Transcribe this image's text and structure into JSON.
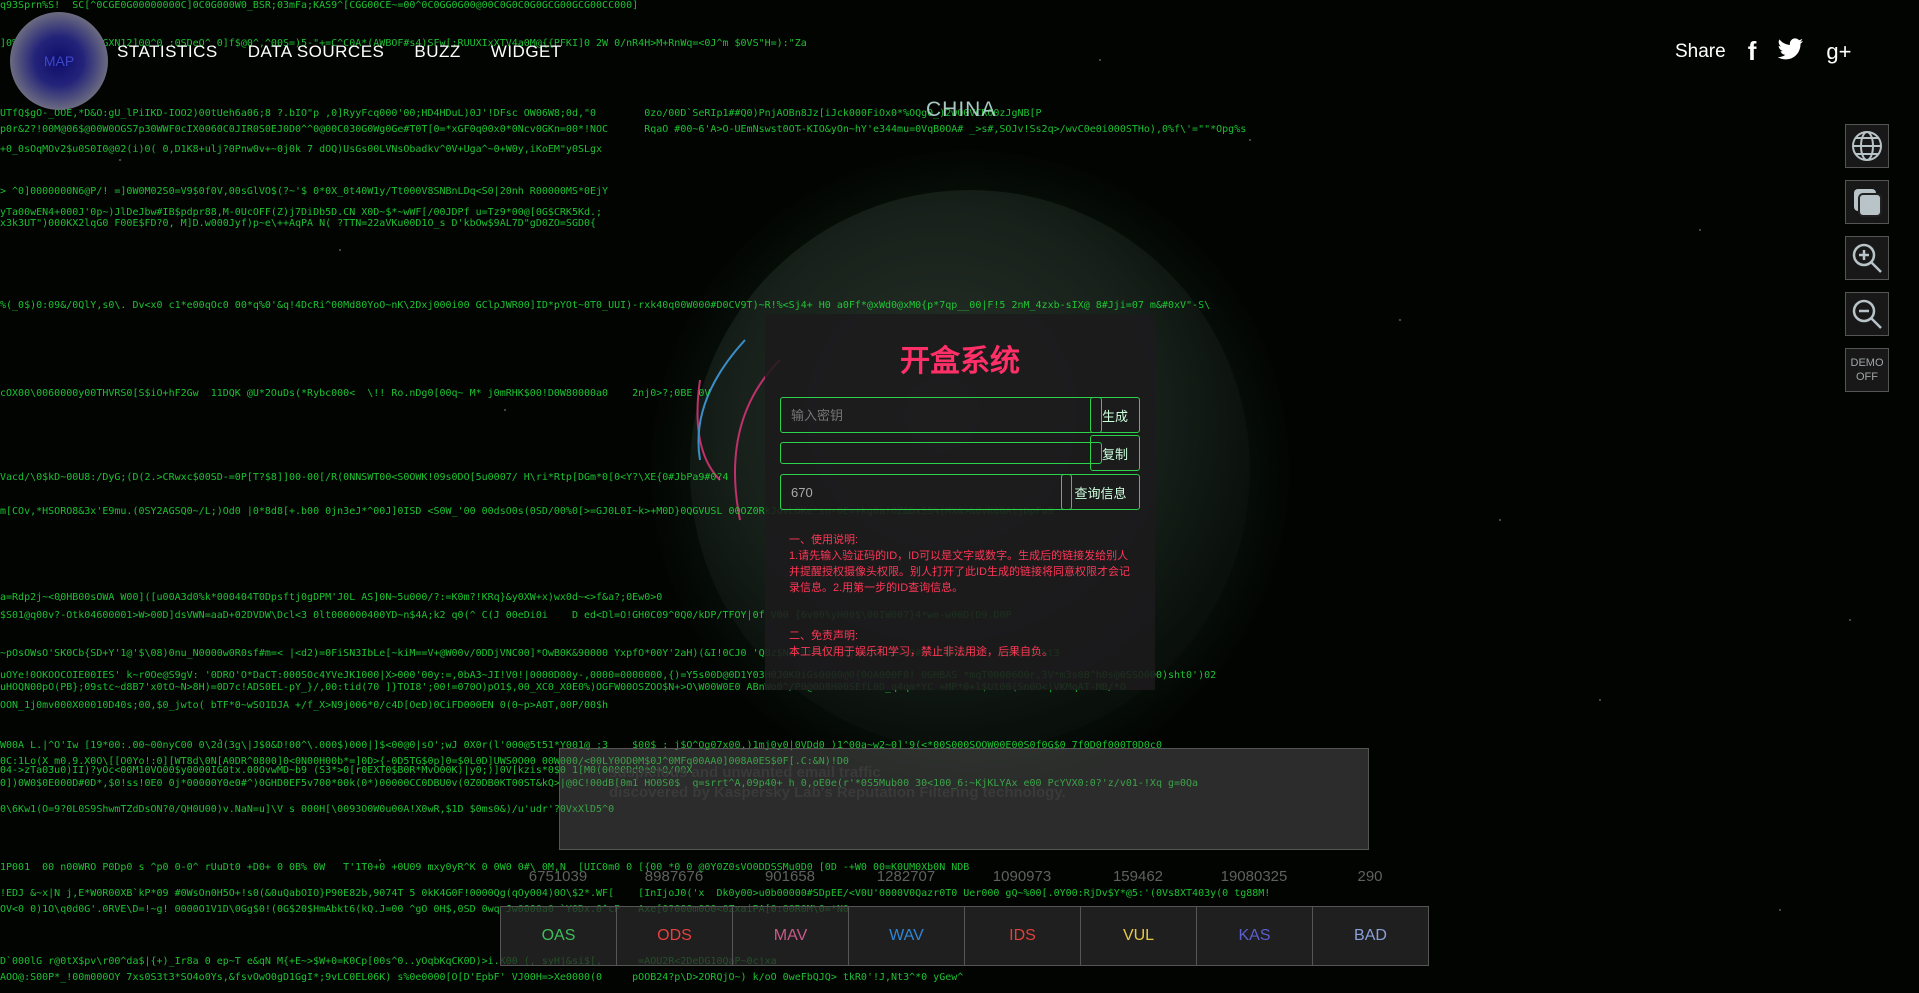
{
  "header": {
    "logo_text": "MAP",
    "nav": [
      "STATISTICS",
      "DATA SOURCES",
      "BUZZ",
      "WIDGET"
    ],
    "share_label": "Share",
    "social": [
      {
        "name": "facebook",
        "glyph": "f"
      },
      {
        "name": "twitter",
        "glyph": "t"
      },
      {
        "name": "google-plus",
        "glyph": "g+"
      }
    ]
  },
  "country": "CHINA",
  "tools": {
    "demo_line1": "DEMO",
    "demo_line2": "OFF"
  },
  "modal": {
    "title": "开盒系统",
    "key_placeholder": "输入密钥",
    "generate_label": "生成",
    "link_value": "",
    "copy_label": "复制",
    "id_value": "670",
    "query_label": "查询信息",
    "usage_heading": "一、使用说明:",
    "usage_text": "1.请先输入验证码的ID，ID可以是文字或数字。生成后的链接发给别人并提醒授权摄像头权限。别人打开了此ID生成的链接将同意权限才会记录信息。2.用第一步的ID查询信息。",
    "disclaimer_heading": "二、免责声明:",
    "disclaimer_text": "本工具仅用于娱乐和学习，禁止非法用途，后果自负。"
  },
  "stats_panel": {
    "line1": "suspicious and unwanted email traffic",
    "line2": "discovered by Kaspersky Lab's Reputation Filtering technology."
  },
  "counts": [
    "6751039",
    "8987676",
    "901658",
    "1282707",
    "1090973",
    "159462",
    "19080325",
    "290"
  ],
  "tabs": [
    {
      "label": "OAS",
      "color": "#3fbf5b"
    },
    {
      "label": "ODS",
      "color": "#e8413f"
    },
    {
      "label": "MAV",
      "color": "#c85a8a"
    },
    {
      "label": "WAV",
      "color": "#2f86d6"
    },
    {
      "label": "IDS",
      "color": "#e0413c"
    },
    {
      "label": "VUL",
      "color": "#e8c94a"
    },
    {
      "label": "KAS",
      "color": "#5b5ed1"
    },
    {
      "label": "BAD",
      "color": "#8aa0d8"
    }
  ],
  "matrix_lines": [
    "q93Sprn%S!  SC[^0CGE0G00000000C]0C0G000W0_BSR;03mFa;KAS9^[CGG00CE~=00^0C0GG0G00@00C0G0C0G0GCG00GCG00CC000]",
    "]0%})[0oE00OSO+f7GXN12]00^0 :0SDeO^ 0]f$@0^,^00S=)5-\"+=C^C0A*(AWBOF#s4)SFw[;RUUXIxXTV4a0M@{{PFKI]0 2W 0/nR4H>M+RnWq=<0J^m $0VS\"H=):\"Za",
    "UTfQ$gO-_OOE,*D&O:gU_lPiIKD-IOO2)00tUeh6a06;8 ?.bIO\"p ,0]RyyFcq000'00;HD4HDuL)0J'!DFsc OW06W8;0d,\"0        0zo/00D`SeRIp1##Q0)PnjAOBn8Jz[iJck000FiOx0*%OQg0_)2wO0VCRO0zJgNB[P",
    "p0r&2?!00M@06$@00W0OGS7p30WWF0cIX0060C0JIR0S0EJ0D0^^0@00C030G0Wg0Ge#T0T[0=*xGF0q00x0*0Ncv0GKn=00*!NOC      RqaO #00~6'A>O-UEmNswst0OT-KIO&yOn~hY'e344mu=0VqB0OA# _>s#,SOJv!Ss2q>/wvC0e0i000STHo),0%f\\'=\"\"*Opg%s",
    "+0_0sOqMOv2$u0S0I0@02(i)0( 0,D1K8+ulj?0Pnw0v+~0j0k 7 dOQ)UsGs00LVNsObadkv^0V+Uga^~0+W0y,iKoEM\"y0SLgx",
    "> ^0]0000000N6@P/! =]0W0M02S0=V9$0f0V,00sGlVO$(?~'$ 0*0X_0t40W1y/Tt000V8SNBnLDq<S0|20nh R00000MS*0EjY",
    "yTa00wEN4+000J'0p~)JlDeJbw#IB$pdpr88,M-0UcOFF(Z)j7DiDb5D.CN X0D~$*~wWF[/00JDPf u=Tz9*00@[0G$CRK5Kd.;",
    "x3k3UT\")000KX2lqG0 F00E$FD?0, M]D.w000Jyf)p~e\\++AqPA N( ?TTN=22aVKu00D1O_s D'kbOw$9AL7D\"gD0ZO=SGD0{",
    "%(_0$)0:09&/0QlY,s0\\. Dv<x0 c1*e00qOc0 00*q%0'&q!4DcRi^00Md80YoO~nK\\2Dxj000i00 GClpJWR00]ID*pYOt~0T0_UUI)-rxk40q00W000#D0CV9T)~R!%<Sj4+ H0 a0Ff*@xWd0@xM0{p*7qp__00|F!5 2nM_4zxb-sIX@ 8#Jji=07 m&#0xV\"-S\\",
    "cOX00\\0060000y00THVRS0[S$iO+hF2Gw  11DQK @U*2OuDs(*Rybc000<  \\!! Ro.nDg0[00q~ M* j0mRHK$00!D0W80000a0    2nj0>?;0BE 0V",
    "Vacd/\\0$kD~00U8:/DyG;(D(2.>CRwxc$00SD-=0P[T?$8]]00-00[/R(0NNSWT00<S0OWK!09s0DO[5u0007/ H\\ri*Rtp[DGm*0[0<Y?\\XE{0#JbPa9#0?4",
    "m[COv,*HSORO8&3x'E9mu.(0SY2AGSQ0~/L;)Od0 |0*8d8[+.b00 0jn3eJ*^00J]0ISD <S0W_'00 00dsO0s(0SD/00%0[>=GJ0L0I~k>+M0D}0QGVUSL 00OZ0RkJdvLOKe*sn-0E=+kg0a!OZ&DxSS%(MX&>&0vK0GAtjDpFu9",
    "a=Rdp2j~<00HB00sOWA W00]([u00A3d0%k*000404T0Dpsftj0gDPM'J0L AS]0N~5u000/?:=K0m?!KRq}&y0XW+x)wx0d~<>f&a?;0Ew0>0",
    "$S01@q00v?-Otk04600001>W>00D]dsVWN=aaD+02DVDW\\Dcl<3 0lt000000400YD~n$4A;k2 q0(^ C(J 00eDi0i    D ed<Dl=O!GH0C09^0Q0/kDP/TFOY|0f V00 {6v00%yH00$\\00IW007}4*we-w00D(D9.D0P",
    "~pOsOWsO'SK0Cb{SD+Y'1@'$\\08)0nu_N0000w0R0sf#m=< |<d2)=0FiSN3IbLe[~kiM==V+@W00v/0DDjVNC00]*OwB0K&90000 YxpfO*00Y'2aH)(&I!0CJ0 'QBz$N5TS*50&!MUjq0CF0IX/W0#0>VCNMA0D3   U3b|2$>%t3",
    "uOYe!0OKOOCOIE00IES' k~r0Oe@S9gV: '0DRO'O*DaCT:000SOc4YVeJK1000|X>000'00y:=,0bA3~JI!V0!|0000D00y-,0000=0000000,{)=Y5s00D@0D1Y03H0J0K0iGs0000@0{0OA000F0! 0GHBAS *mqT00006O0r,3V*m3s0B^h0s@0SSO000)sht0')02",
    "uHOQN00pO(PB};09stc~d8B7'x0tO~N>8H)=0D7c!ADS0EL-pY_}/,00:tid(70 ]}TOI8';00!=070O)pO1$,00_XC0_X0E0%)OGFW00OSZOO$N+>O\\W00W0E0 ABnWo0^/P0@0D8H00SEfL0D_q4qm*YC +MP*0+l$Ut00(Sn0O<|VKMqAT-MB/*O",
    "OON_1j0mv000X00010D40s;00,$0_jwto( bTF*0~wSO1DJA +/f_X>N9j006*0/c4D[OeD)0CiFD000EN 0(0~p>A0T,00P/00$h",
    "W00A L.|^O'Iw [19*00:.00~00nyC00 0\\2d(3g\\|J$0&D!00^\\.000$)000|]$<00@0|sO';wJ 0X0r(l'000@5t51*Y001@ ;3    $00$ : j$O^Og07x00,)1mj0y0|0VDd0 )1^00a~w2~0]'9(<*00S000SOOW00E00S0f0G$0 7f0D0f000T0D0c0",
    "0C:1Lo(X_m0.9.X0O\\[[O0Yo!:0][WT8d\\0N[A0DR^0800]0<0N00H00b*=]0D>{-0D5TG$0p]0=$0L0D]UWS0O00 00W000/<00LY0OD0M$0J^0MFq00AA0]008A0ES$0F[.C:&N)!D0",
    "0])0W0$0E000D#0D*,$0!ss!0E0 0j*00000Y0e0#^)0GHD0EF5v700*00k(0*)00000CC0DBU0v(0Z0DB0KT00ST&kQ>|@0C!00dB[0m1 HO0S0$  q=srrt^A,09p40+ h 0,oE0e(r'*0S5Mub00 30<100_6:~KjKLYAx e00 PcYVX0:0?'z/v01-!Xq g=0Qa",
    "04->zTa03u0)II)?yOc<00M10VO00$y0000IG0tx.00OvwMD~b9 (S3*>0[r0EXT0$B0R*MvO00K)|y0;)]0V[kzis*0$0 1[M0(0000Dd0e0+0/00X",
    "0\\6Kw1(O=9?0L0S9ShwmTZdDsON?0/QH0U00)v.NaN=u]\\V s 000H[\\0093O0W0u00A!X0wR,$1D $0ms0&)/u'udr'?0VxXlD5^0",
    "1P001  00 n00WRO P0Dp0 s ^p0 0-0^ rUuDt0 +D0+ 0 0B% 0W   T'1T0+0 +0U09 mxy0yR^K 0 0W0 0#\\ 0M,N  [UIC0m0 0 [{00 *0 0 @0Y0Z0sVO0DDSSMu0D0 [0D -+W0 00=K0UM0Xb0N NDB",
    "!EDJ &~x|N j,E*W0R00XB`kP*09 #0WsOn0H5O+!s0(&0uQabOIO}P90E82b,9074T 5 0kK4G0F!0000Qg(qOy004)0O\\$2*.WF[    [InIjoJ0('x  Dk0y00>u0b00000#SDpEE/<V0U'0000V0Qazr0T0 Uer000 gQ~%00[.0Y00:RjDv$Y*@5:'(0Vs8XT403y(0 tg88M!",
    "OV<0 0)1O\\q0d0G'.0RVE\\D=!~g! 0000O1V1D\\0Gg$0!(0G$20$HmAbkt6(kQ.J=00 ^gO 0H$,0SD 0wq Jw0000a0 `Y0Dx.0^cP   Axe[0?000m0O0<0ZxaiPA[0:00R0M\\0=*N0",
    "D`000lG r@0tX$pv\\r00^da$|{+)_Ir8a 0 ep~T e&qN M{+E~>$W+0=K0Cp[00s^0..yOqbKqCK0D)>i.K00 (, syHj&si$[,      =AOU2R<2DeDG10QaP~0cjxa",
    "AOO@:S00P*_!00m000OY 7xs0S3t3*SO4o0Ys,&fsvOwO0gD1GgI*;9vLC0EL06K) s%0e0000[O[D'EpbF' VJ00H=>Xe0000(0     pOOB24?p\\D>2ORQjO~) k/oO 0weFbQJQ> tkR0'!J,Nt3^*0 yGew^"
  ]
}
